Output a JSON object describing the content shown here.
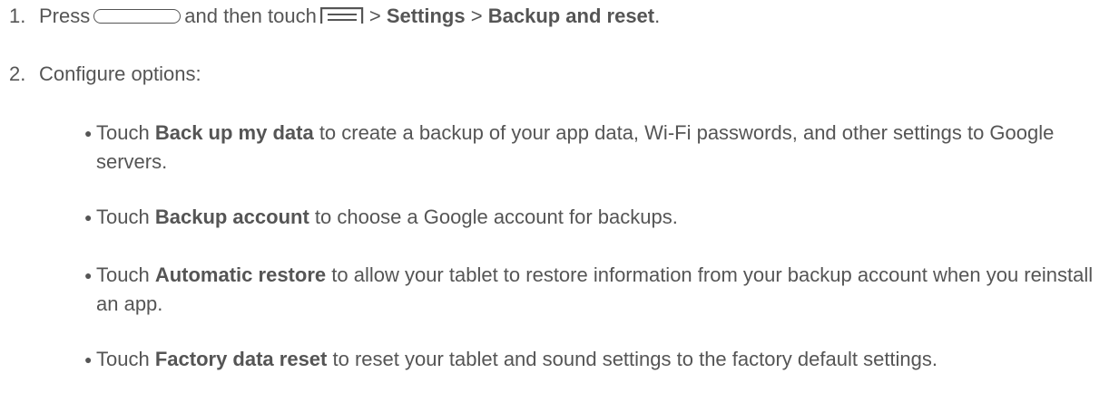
{
  "step1": {
    "number": "1.",
    "prefix": "Press",
    "home_key_icon": "home-key-icon",
    "middle": "and then touch",
    "menu_key_icon": "menu-key-icon",
    "sep1": ">",
    "settings": "Settings",
    "sep2": ">",
    "backup_reset": "Backup and reset",
    "end": "."
  },
  "step2": {
    "number": "2.",
    "text": "Configure options:"
  },
  "bullets": [
    {
      "lead": "Touch",
      "bold": "Back up my data",
      "rest": "to create a backup of your app data, Wi-Fi passwords, and other settings to Google servers."
    },
    {
      "lead": "Touch",
      "bold": "Backup account",
      "rest": "to choose a Google account for backups."
    },
    {
      "lead": "Touch",
      "bold": "Automatic restore",
      "rest": "to allow your tablet to restore information from your backup account when you reinstall an app."
    },
    {
      "lead": "Touch",
      "bold": "Factory data reset",
      "rest": "to reset your tablet and sound settings to the factory default settings."
    }
  ]
}
